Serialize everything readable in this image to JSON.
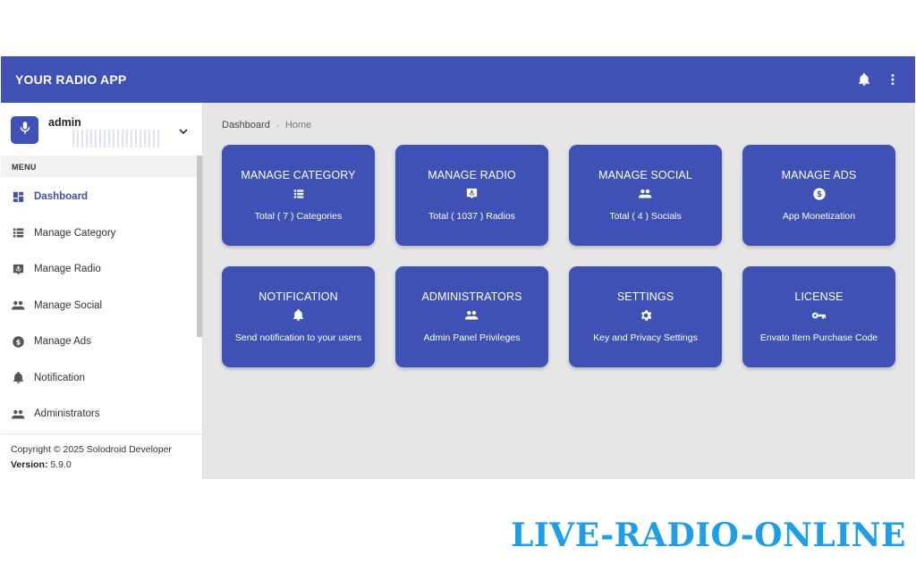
{
  "topbar": {
    "title": "YOUR RADIO APP",
    "icons": [
      "bell-icon",
      "more-vertical-icon"
    ]
  },
  "user": {
    "name": "admin",
    "avatar_icon": "microphone-icon"
  },
  "sidebar": {
    "menu_header": "MENU",
    "items": [
      {
        "label": "Dashboard",
        "icon": "dashboard-icon",
        "active": true
      },
      {
        "label": "Manage Category",
        "icon": "list-icon"
      },
      {
        "label": "Manage Radio",
        "icon": "radio-icon"
      },
      {
        "label": "Manage Social",
        "icon": "people-icon"
      },
      {
        "label": "Manage Ads",
        "icon": "dollar-icon"
      },
      {
        "label": "Notification",
        "icon": "bell-icon"
      },
      {
        "label": "Administrators",
        "icon": "people-icon"
      }
    ]
  },
  "footer": {
    "copyright": "Copyright © 2025 Solodroid Developer",
    "version_label": "Version:",
    "version_value": "5.9.0"
  },
  "breadcrumb": {
    "root": "Dashboard",
    "current": "Home"
  },
  "cards": [
    {
      "title": "MANAGE CATEGORY",
      "icon": "list-icon",
      "desc": "Total ( 7 ) Categories"
    },
    {
      "title": "MANAGE RADIO",
      "icon": "radio-icon",
      "desc": "Total ( 1037 ) Radios"
    },
    {
      "title": "MANAGE SOCIAL",
      "icon": "people-icon",
      "desc": "Total ( 4 ) Socials"
    },
    {
      "title": "MANAGE ADS",
      "icon": "dollar-icon",
      "desc": "App Monetization"
    },
    {
      "title": "NOTIFICATION",
      "icon": "bell-icon",
      "desc": "Send notification to your users"
    },
    {
      "title": "ADMINISTRATORS",
      "icon": "people-icon",
      "desc": "Admin Panel Privileges"
    },
    {
      "title": "SETTINGS",
      "icon": "gear-icon",
      "desc": "Key and Privacy Settings"
    },
    {
      "title": "LICENSE",
      "icon": "key-icon",
      "desc": "Envato Item Purchase Code"
    }
  ],
  "watermark": "LIVE-RADIO-ONLINE",
  "colors": {
    "primary": "#3f51b5",
    "background": "#e6e6e6",
    "watermark": "#1c9ee8"
  }
}
